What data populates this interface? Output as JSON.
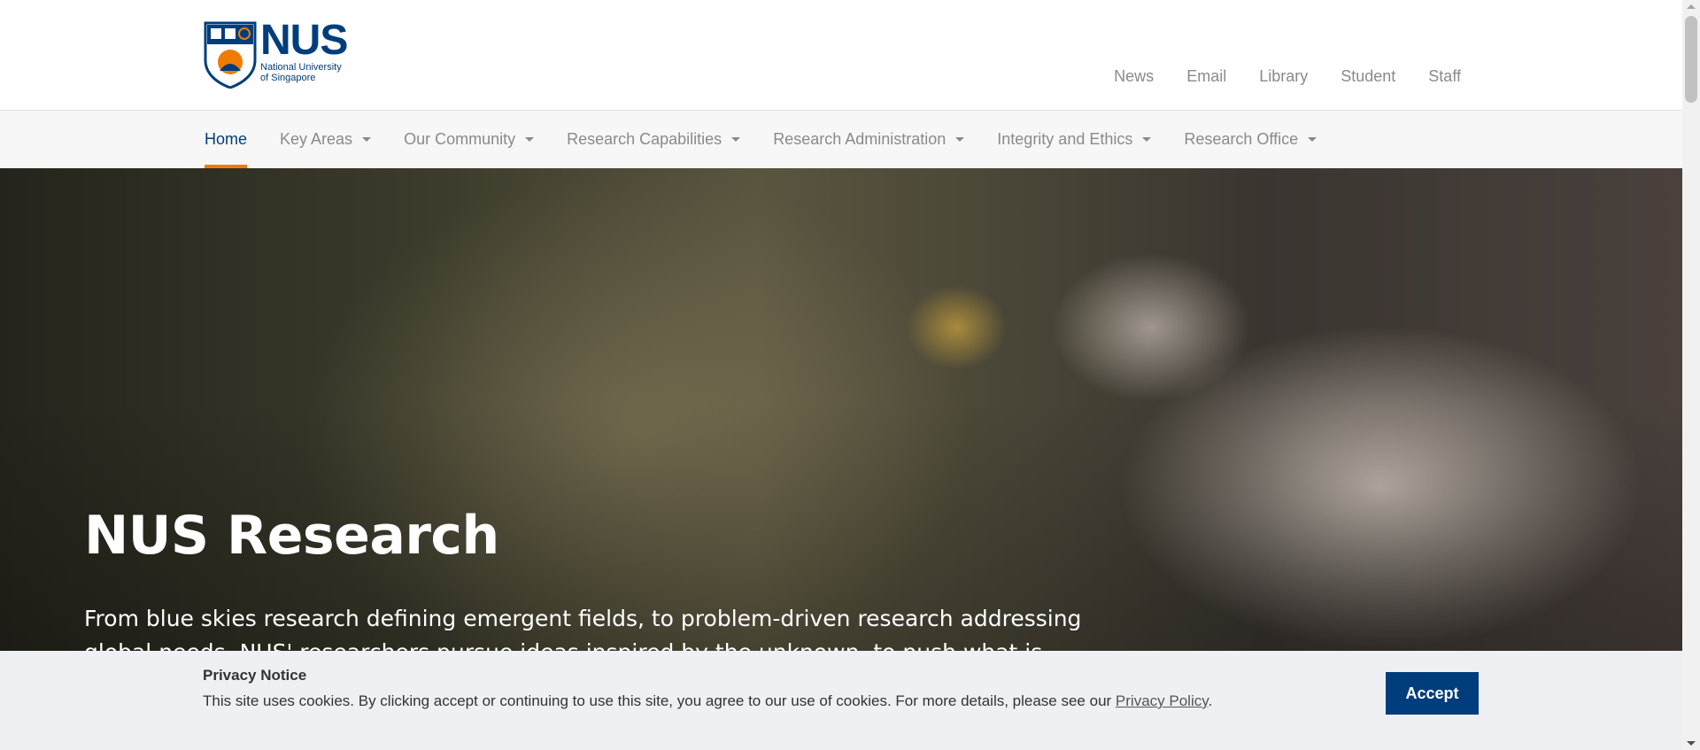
{
  "header": {
    "logo_name": "NUS",
    "logo_subtitle_line1": "National University",
    "logo_subtitle_line2": "of Singapore",
    "utility_links": [
      "News",
      "Email",
      "Library",
      "Student",
      "Staff"
    ]
  },
  "nav": {
    "items": [
      {
        "label": "Home",
        "active": true,
        "dropdown": false
      },
      {
        "label": "Key Areas",
        "active": false,
        "dropdown": true
      },
      {
        "label": "Our Community",
        "active": false,
        "dropdown": true
      },
      {
        "label": "Research Capabilities",
        "active": false,
        "dropdown": true
      },
      {
        "label": "Research Administration",
        "active": false,
        "dropdown": true
      },
      {
        "label": "Integrity and Ethics",
        "active": false,
        "dropdown": true
      },
      {
        "label": "Research Office",
        "active": false,
        "dropdown": true
      }
    ]
  },
  "hero": {
    "title": "NUS Research",
    "description": "From blue skies research defining emergent fields, to problem-driven research addressing global needs, NUS' researchers pursue ideas inspired by the unknown, to push what is"
  },
  "cookie": {
    "title": "Privacy Notice",
    "text": "This site uses cookies. By clicking accept or continuing to use this site, you agree to our use of cookies. For more details, please see our ",
    "link_label": "Privacy Policy",
    "text_end": ".",
    "accept_label": "Accept"
  },
  "colors": {
    "brand_blue": "#003d7c",
    "brand_orange": "#ef7c00",
    "nav_text": "#8a8a8a"
  },
  "icons": [
    "nus-crest-icon",
    "chevron-down-icon"
  ]
}
